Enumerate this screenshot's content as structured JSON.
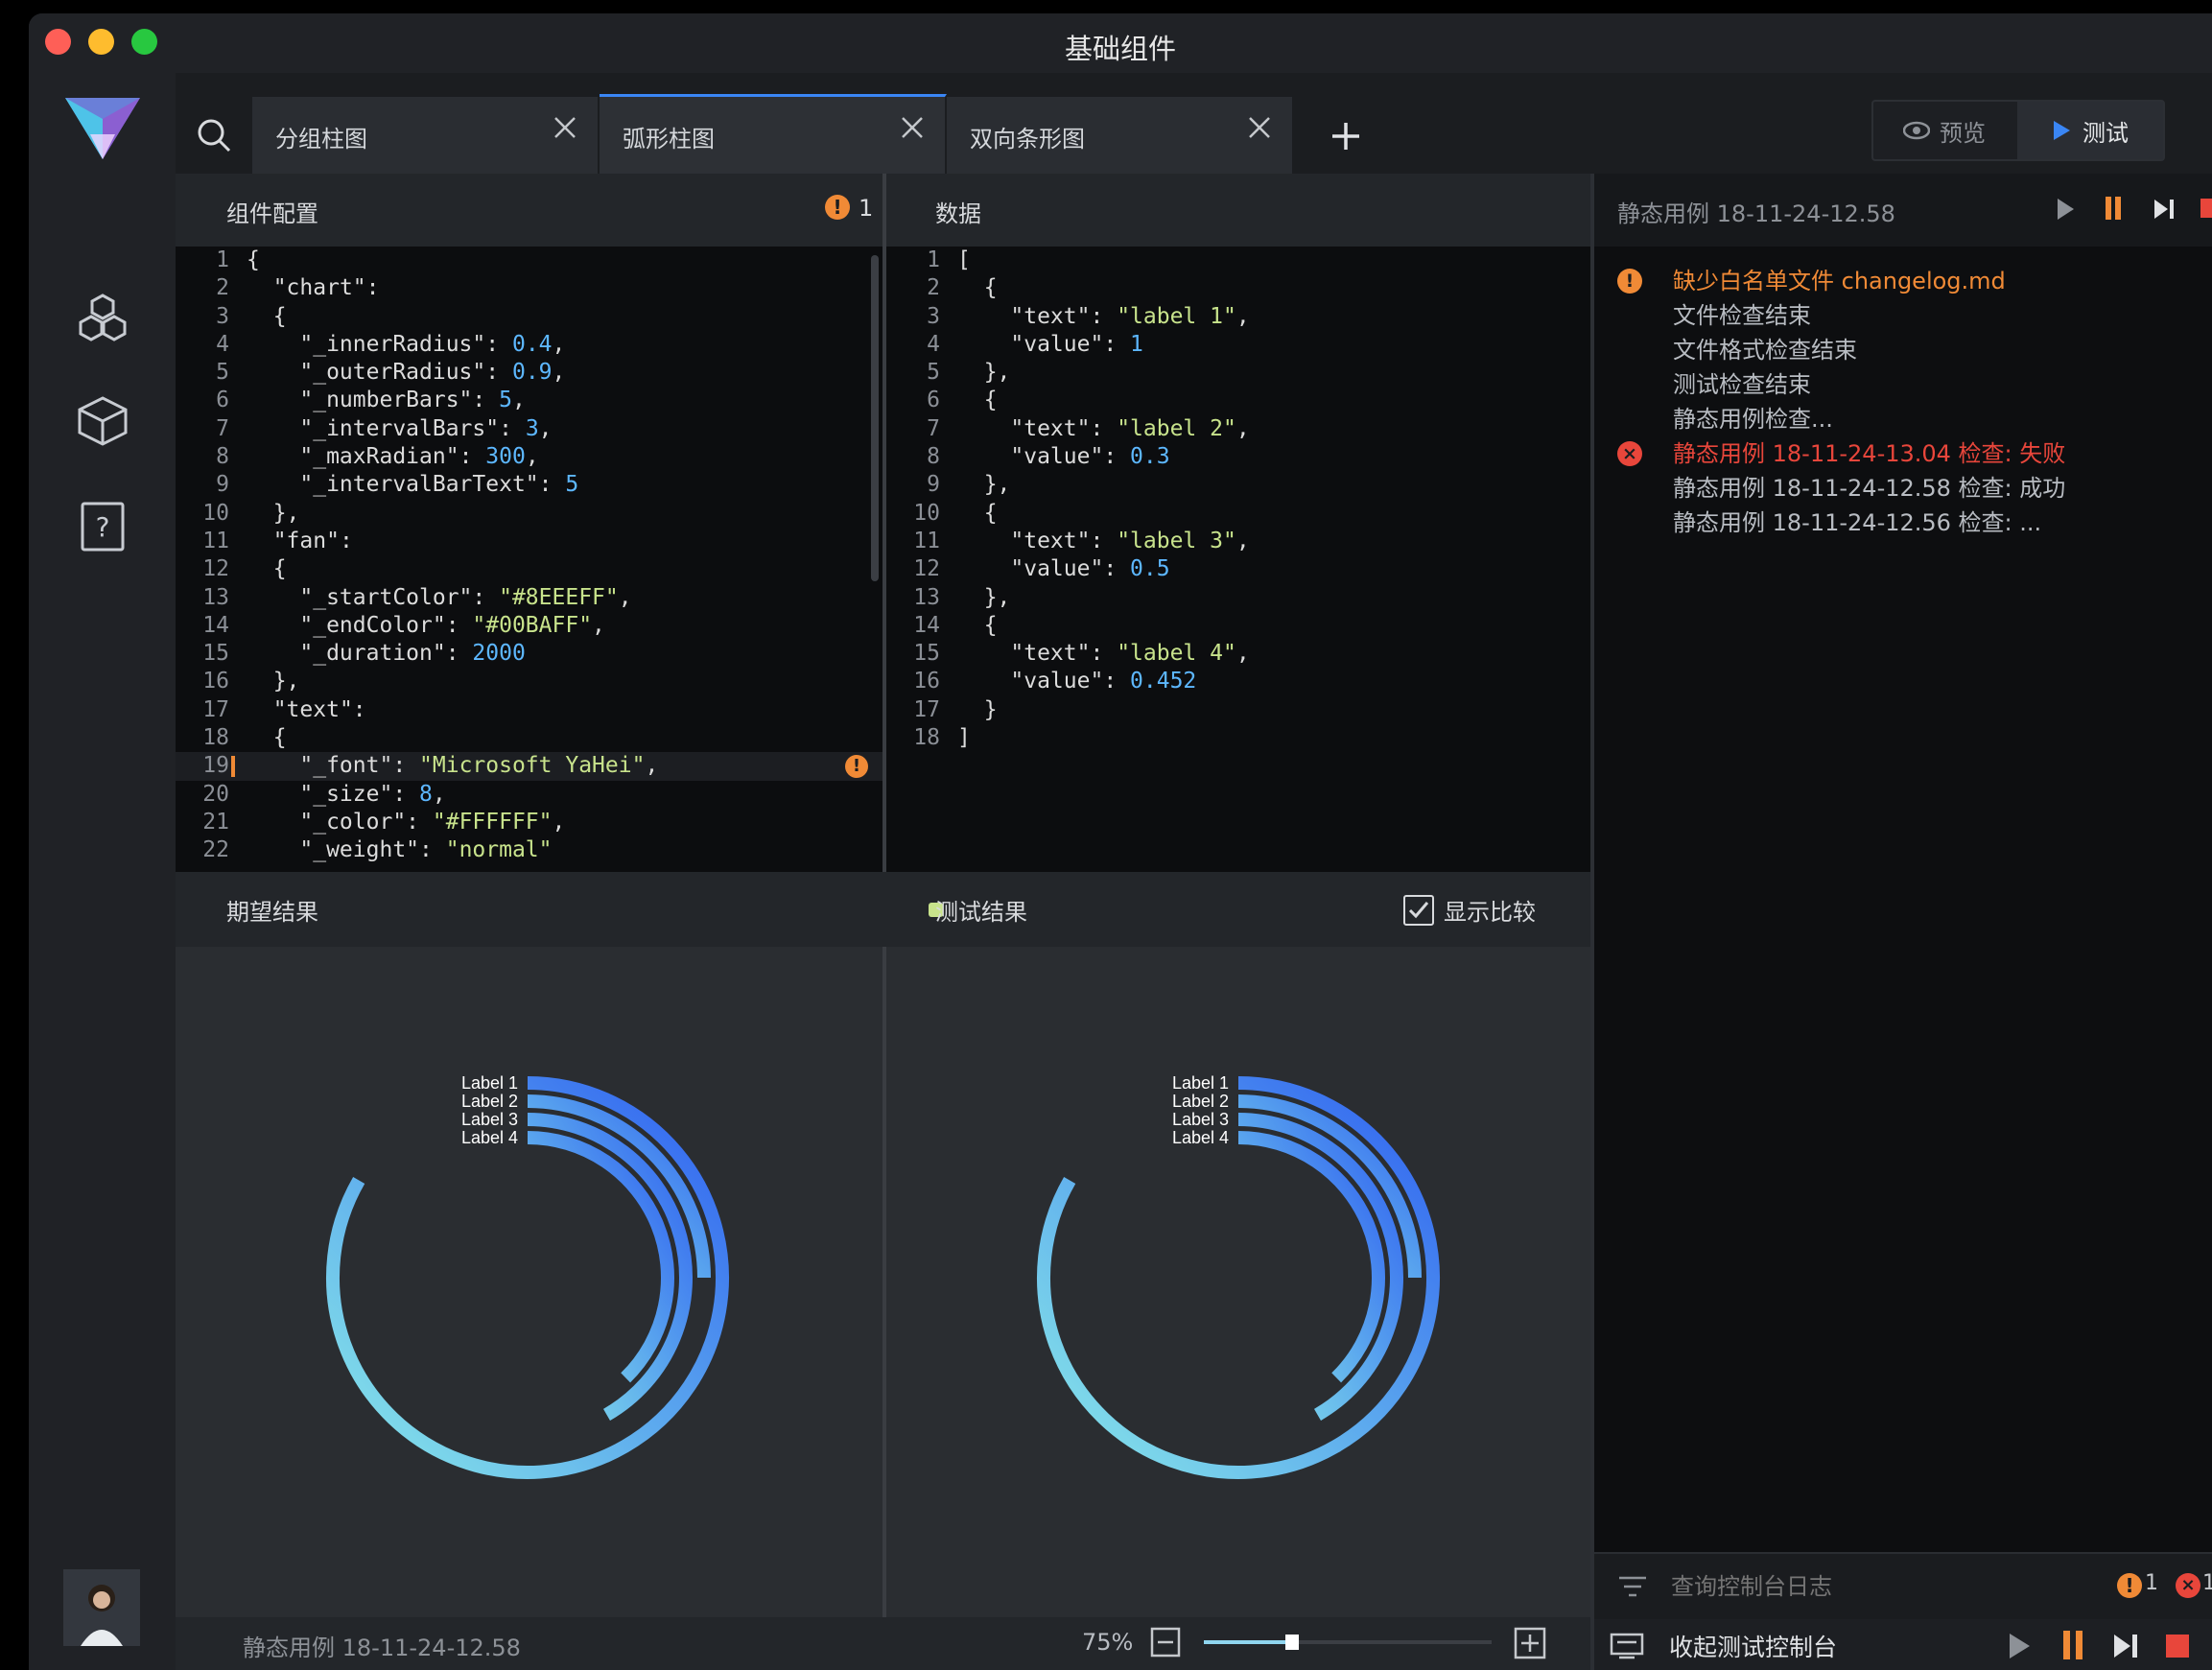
{
  "window": {
    "title": "基础组件"
  },
  "tabs": [
    {
      "label": "分组柱图",
      "active": false
    },
    {
      "label": "弧形柱图",
      "active": true
    },
    {
      "label": "双向条形图",
      "active": false
    }
  ],
  "toolbar": {
    "preview_label": "预览",
    "test_label": "测试"
  },
  "config_panel": {
    "title": "组件配置",
    "warning_count": "1",
    "lines": [
      "{",
      "  \"chart\":",
      "  {",
      "    \"_innerRadius\": 0.4,",
      "    \"_outerRadius\": 0.9,",
      "    \"_numberBars\": 5,",
      "    \"_intervalBars\": 3,",
      "    \"_maxRadian\": 300,",
      "    \"_intervalBarText\": 5",
      "  },",
      "  \"fan\":",
      "  {",
      "    \"_startColor\": \"#8EEEFF\",",
      "    \"_endColor\": \"#00BAFF\",",
      "    \"_duration\": 2000",
      "  },",
      "  \"text\":",
      "  {",
      "    \"_font\": \"Microsoft YaHei\",",
      "    \"_size\": 8,",
      "    \"_color\": \"#FFFFFF\",",
      "    \"_weight\": \"normal\""
    ]
  },
  "data_panel": {
    "title": "数据",
    "lines": [
      "[",
      "  {",
      "    \"text\": \"label 1\",",
      "    \"value\": 1",
      "  },",
      "  {",
      "    \"text\": \"label 2\",",
      "    \"value\": 0.3",
      "  },",
      "  {",
      "    \"text\": \"label 3\",",
      "    \"value\": 0.5",
      "  },",
      "  {",
      "    \"text\": \"label 4\",",
      "    \"value\": 0.452",
      "  }",
      "]"
    ]
  },
  "console": {
    "header": "静态用例 18-11-24-12.58",
    "messages": [
      {
        "text": "缺少白名单文件 changelog.md",
        "level": "warning"
      },
      {
        "text": "文件检查结束",
        "level": "info"
      },
      {
        "text": "文件格式检查结束",
        "level": "info"
      },
      {
        "text": "测试检查结束",
        "level": "info"
      },
      {
        "text": "静态用例检查...",
        "level": "info"
      },
      {
        "text": "静态用例 18-11-24-13.04 检查: 失败",
        "level": "error"
      },
      {
        "text": "静态用例 18-11-24-12.58 检查: 成功",
        "level": "info"
      },
      {
        "text": "静态用例 18-11-24-12.56 检查: ...",
        "level": "info"
      }
    ],
    "filter_placeholder": "查询控制台日志",
    "warning_count": "1",
    "error_count": "1",
    "collapse_label": "收起测试控制台"
  },
  "results": {
    "expected_title": "期望结果",
    "actual_title": "测试结果",
    "compare_label": "显示比较",
    "compare_checked": true
  },
  "chart_data": [
    {
      "type": "radial-bar",
      "title": "期望结果",
      "categories": [
        "Label 1",
        "Label 2",
        "Label 3",
        "Label 4"
      ],
      "values": [
        1,
        0.3,
        0.5,
        0.452
      ],
      "max_radian_deg": 300,
      "start_color": "#8EEEFF",
      "end_color": "#00BAFF"
    },
    {
      "type": "radial-bar",
      "title": "测试结果",
      "categories": [
        "Label 1",
        "Label 2",
        "Label 3",
        "Label 4"
      ],
      "values": [
        1,
        0.3,
        0.5,
        0.452
      ],
      "max_radian_deg": 300,
      "start_color": "#8EEEFF",
      "end_color": "#00BAFF"
    }
  ],
  "footer": {
    "case_label": "静态用例 18-11-24-12.58",
    "zoom": "75%"
  }
}
